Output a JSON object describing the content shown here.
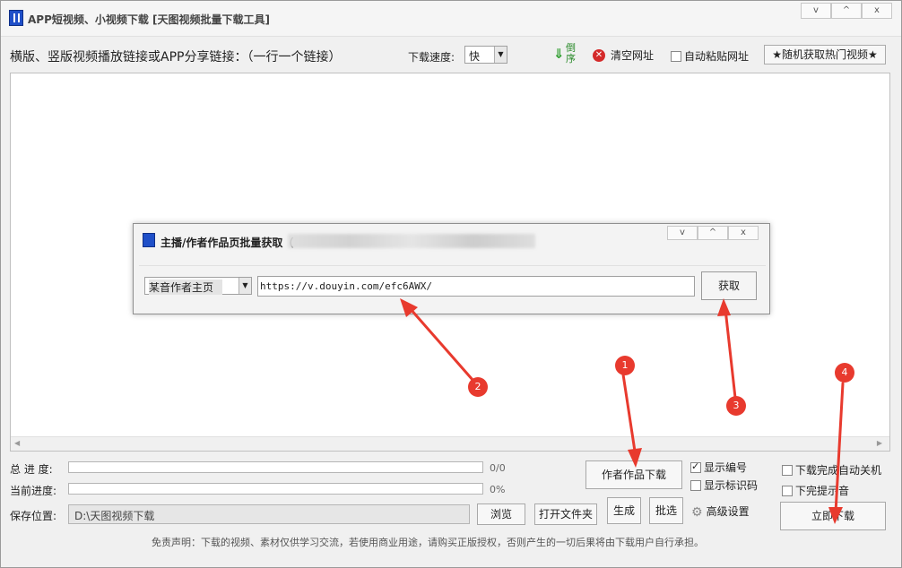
{
  "window": {
    "title": "APP短视频、小视频下载 [天图视频批量下载工具]",
    "controls": [
      "v",
      "^",
      "x"
    ]
  },
  "toolbar": {
    "links_label": "横版、竖版视频播放链接或APP分享链接：（一行一个链接）",
    "speed_label": "下载速度:",
    "speed_value": "快",
    "reverse_label": "倒序",
    "clear_label": "清空网址",
    "autopaste_label": "自动粘贴网址",
    "random_label": "★随机获取热门视频★"
  },
  "dialog": {
    "title": "主播/作者作品页批量获取（",
    "controls": [
      "v",
      "^",
      "x"
    ],
    "source_value": "某音作者主页",
    "url_value": "https://v.douyin.com/efc6AWX/",
    "fetch_label": "获取"
  },
  "bottom": {
    "total_label": "总 进 度:",
    "total_value": "0/0",
    "total_progress": 0,
    "current_label": "当前进度:",
    "current_value": "0%",
    "current_progress": 0,
    "save_label": "保存位置:",
    "save_path": "D:\\天图视频下载",
    "browse_label": "浏览",
    "open_folder_label": "打开文件夹",
    "author_download_label": "作者作品下载",
    "generate_label": "生成",
    "pick_label": "批选",
    "show_number_label": "显示编号",
    "show_number_checked": true,
    "show_id_label": "显示标识码",
    "show_id_checked": false,
    "advanced_label": "高级设置",
    "shutdown_label": "下载完成自动关机",
    "sound_label": "下完提示音",
    "download_now_label": "立即下载",
    "disclaimer": "免责声明：下载的视频、素材仅供学习交流，若使用商业用途，请购买正版授权，否则产生的一切后果将由下载用户自行承担。"
  },
  "annotations": {
    "color": "#e83a2e",
    "badges": [
      "1",
      "2",
      "3",
      "4"
    ]
  }
}
